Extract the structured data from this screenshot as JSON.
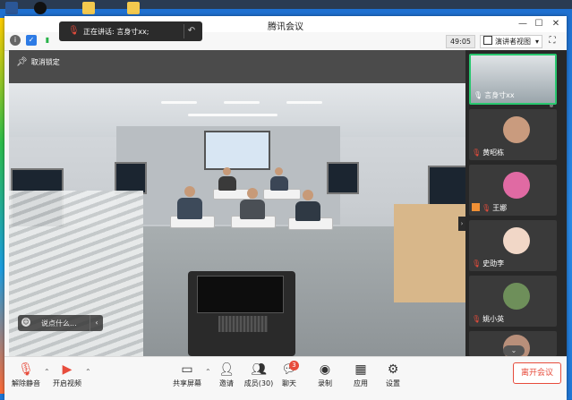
{
  "window": {
    "title": "腾讯会议"
  },
  "speaking": {
    "label": "正在讲话: 言身寸xx;"
  },
  "toolbar": {
    "timer": "49:05",
    "view_label": "演讲者视图"
  },
  "stage": {
    "unpin_label": "取消锁定",
    "chat_preview": "说点什么..."
  },
  "participants": [
    {
      "name": "言身寸xx",
      "active": true,
      "avatar_color": "#9ab3c1"
    },
    {
      "name": "黄昭栋",
      "active": false,
      "avatar_color": "#c99b7e"
    },
    {
      "name": "王娜",
      "active": false,
      "host": true,
      "avatar_color": "#e06aa3"
    },
    {
      "name": "史劭李",
      "active": false,
      "avatar_color": "#f1d7c7"
    },
    {
      "name": "姚小英",
      "active": false,
      "avatar_color": "#6e8f5a"
    },
    {
      "name": "",
      "active": false,
      "avatar_color": "#b88f7a"
    }
  ],
  "controls": {
    "unmute": "解除静音",
    "video": "开启视频",
    "share": "共享屏幕",
    "invite": "邀请",
    "members": "成员(30)",
    "chat": "聊天",
    "chat_badge": "3",
    "record": "录制",
    "apps": "应用",
    "settings": "设置",
    "leave": "离开会议"
  },
  "colors": {
    "leave": "#e74c3c",
    "active_border": "#28c76f",
    "mute": "#e74c3c"
  }
}
